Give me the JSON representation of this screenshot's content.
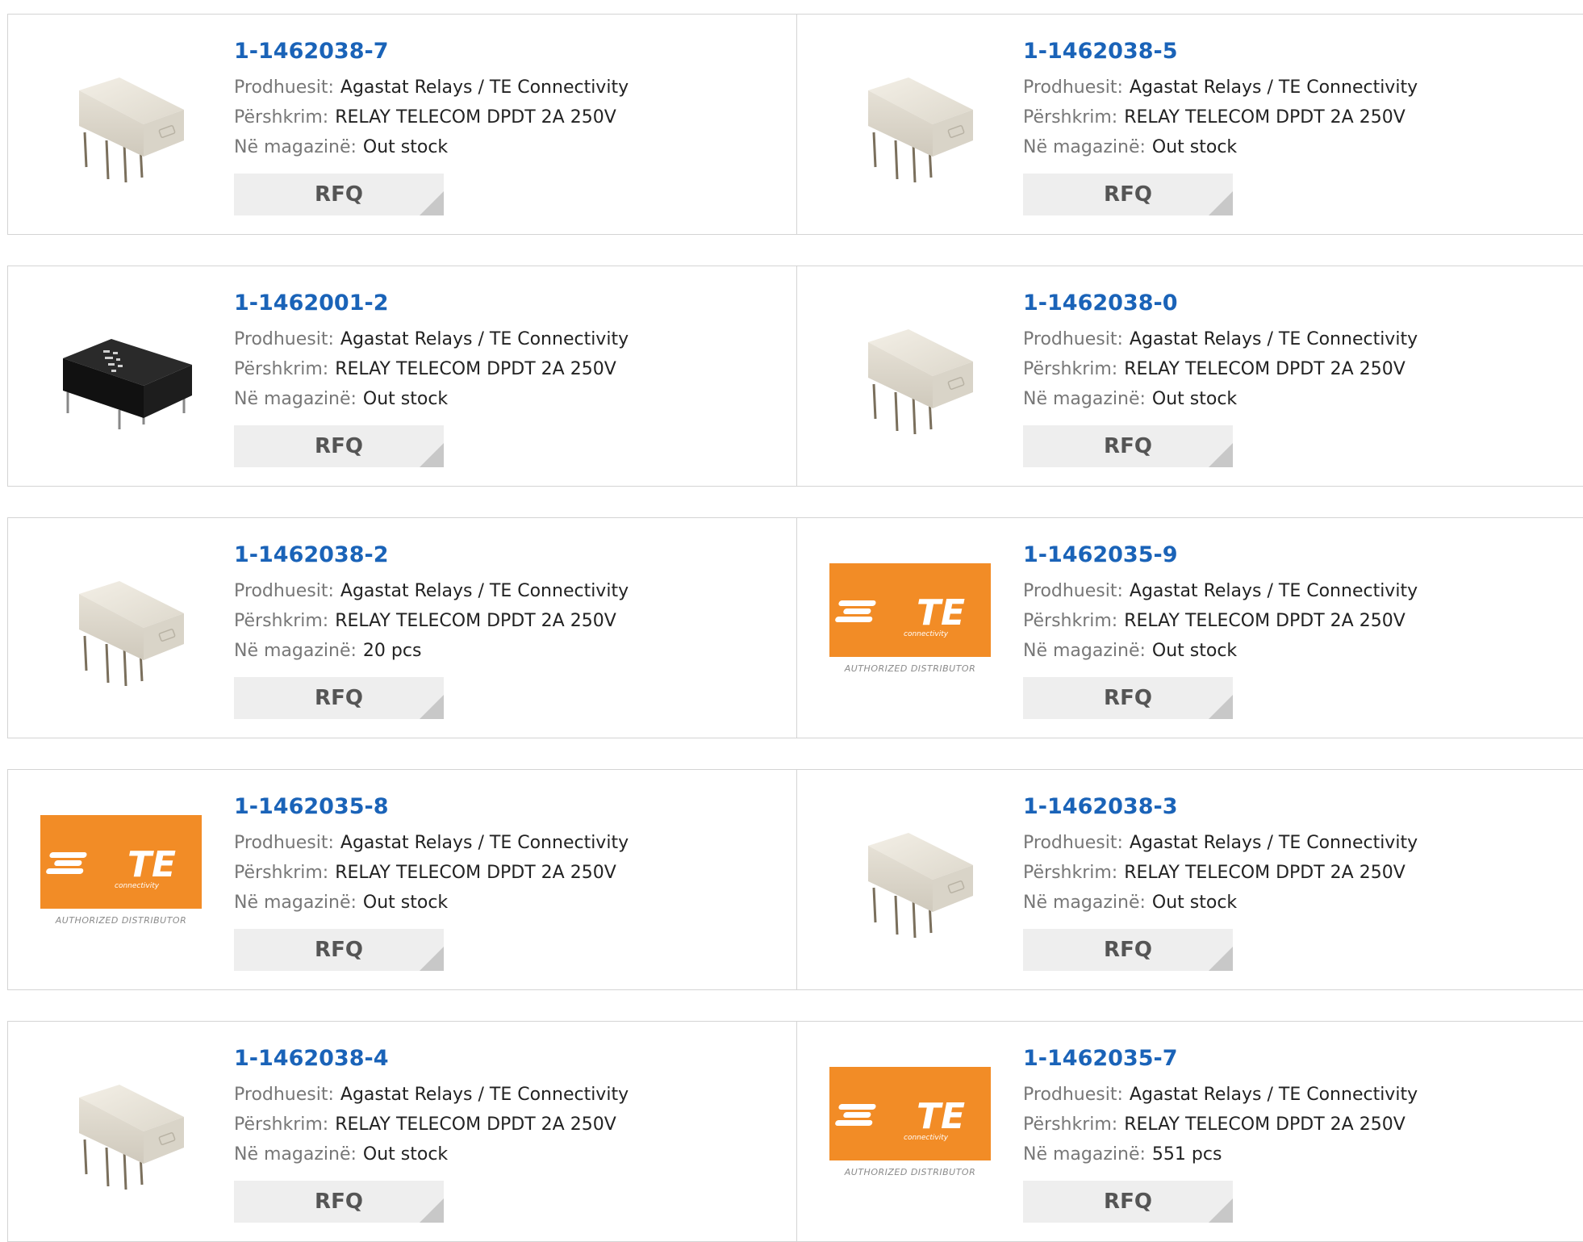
{
  "labels": {
    "manufacturer": "Prodhuesit:",
    "description": "Përshkrim:",
    "stock": "Në magazinë:",
    "rfq": "RFQ",
    "te_word": "TE",
    "te_sub": "connectivity",
    "te_dist": "AUTHORIZED DISTRIBUTOR"
  },
  "colors": {
    "link": "#1a63b8",
    "te_orange": "#f28c26",
    "border": "#d4d4d4",
    "button_bg": "#eeeeee"
  },
  "products": [
    {
      "part": "1-1462038-7",
      "image": "white-relay-icon",
      "manufacturer": "Agastat Relays / TE Connectivity",
      "description": "RELAY TELECOM DPDT 2A 250V",
      "stock": "Out stock"
    },
    {
      "part": "1-1462038-5",
      "image": "white-relay-icon",
      "manufacturer": "Agastat Relays / TE Connectivity",
      "description": "RELAY TELECOM DPDT 2A 250V",
      "stock": "Out stock"
    },
    {
      "part": "1-1462001-2",
      "image": "black-relay-icon",
      "manufacturer": "Agastat Relays / TE Connectivity",
      "description": "RELAY TELECOM DPDT 2A 250V",
      "stock": "Out stock"
    },
    {
      "part": "1-1462038-0",
      "image": "white-relay-icon",
      "manufacturer": "Agastat Relays / TE Connectivity",
      "description": "RELAY TELECOM DPDT 2A 250V",
      "stock": "Out stock"
    },
    {
      "part": "1-1462038-2",
      "image": "white-relay-icon",
      "manufacturer": "Agastat Relays / TE Connectivity",
      "description": "RELAY TELECOM DPDT 2A 250V",
      "stock": "20 pcs"
    },
    {
      "part": "1-1462035-9",
      "image": "te-logo-icon",
      "manufacturer": "Agastat Relays / TE Connectivity",
      "description": "RELAY TELECOM DPDT 2A 250V",
      "stock": "Out stock"
    },
    {
      "part": "1-1462035-8",
      "image": "te-logo-icon",
      "manufacturer": "Agastat Relays / TE Connectivity",
      "description": "RELAY TELECOM DPDT 2A 250V",
      "stock": "Out stock"
    },
    {
      "part": "1-1462038-3",
      "image": "white-relay-icon",
      "manufacturer": "Agastat Relays / TE Connectivity",
      "description": "RELAY TELECOM DPDT 2A 250V",
      "stock": "Out stock"
    },
    {
      "part": "1-1462038-4",
      "image": "white-relay-icon",
      "manufacturer": "Agastat Relays / TE Connectivity",
      "description": "RELAY TELECOM DPDT 2A 250V",
      "stock": "Out stock"
    },
    {
      "part": "1-1462035-7",
      "image": "te-logo-icon",
      "manufacturer": "Agastat Relays / TE Connectivity",
      "description": "RELAY TELECOM DPDT 2A 250V",
      "stock": "551 pcs"
    }
  ]
}
